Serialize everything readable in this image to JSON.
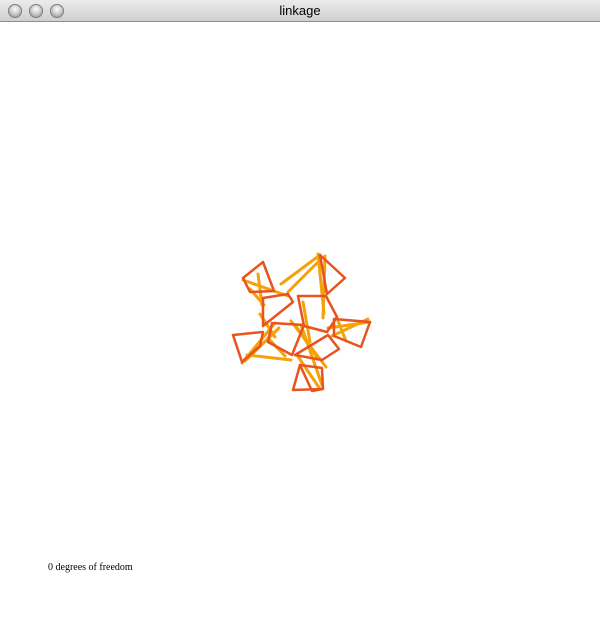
{
  "window": {
    "title": "linkage"
  },
  "status": {
    "freedom_text": "0 degrees of freedom"
  },
  "colors": {
    "outer_links": "#e8531e",
    "inner_links": "#f4a10a",
    "titlebar": "#dcdcdc",
    "background": "#ffffff"
  },
  "icons": {
    "close": "circle-button-icon",
    "minimize": "circle-button-icon",
    "zoom": "circle-button-icon"
  }
}
